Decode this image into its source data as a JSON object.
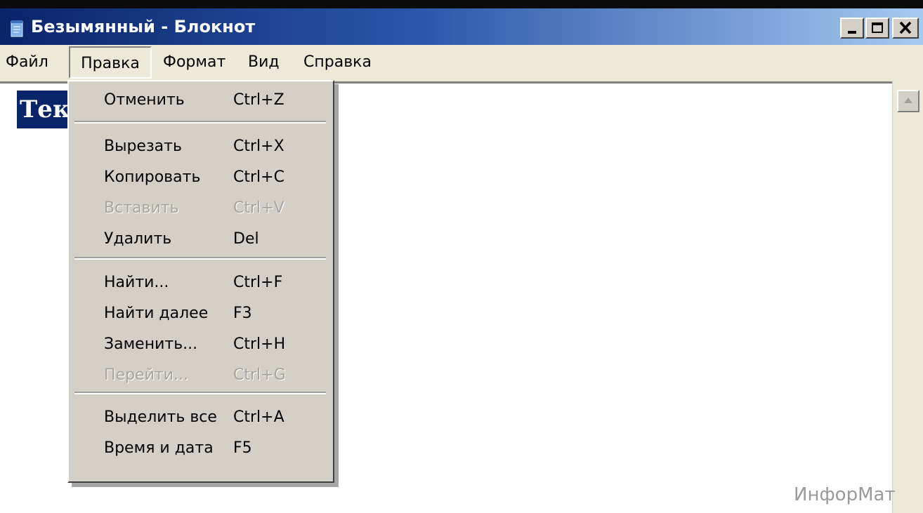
{
  "window": {
    "title": "Безымянный - Блокнот",
    "title_gradient_start": "#0a246a",
    "title_gradient_end": "#a6caf0",
    "icon": "notepad-icon"
  },
  "menubar": {
    "items": [
      {
        "label": "Файл"
      },
      {
        "label": "Правка",
        "open": true
      },
      {
        "label": "Формат"
      },
      {
        "label": "Вид"
      },
      {
        "label": "Справка"
      }
    ]
  },
  "editor": {
    "selected_text": "Тек",
    "selection_color": "#0a246a"
  },
  "edit_menu": {
    "groups": [
      [
        {
          "label": "Отменить",
          "shortcut": "Ctrl+Z",
          "enabled": true
        }
      ],
      [
        {
          "label": "Вырезать",
          "shortcut": "Ctrl+X",
          "enabled": true
        },
        {
          "label": "Копировать",
          "shortcut": "Ctrl+C",
          "enabled": true
        },
        {
          "label": "Вставить",
          "shortcut": "Ctrl+V",
          "enabled": false
        },
        {
          "label": "Удалить",
          "shortcut": "Del",
          "enabled": true
        }
      ],
      [
        {
          "label": "Найти...",
          "shortcut": "Ctrl+F",
          "enabled": true
        },
        {
          "label": "Найти далее",
          "shortcut": "F3",
          "enabled": true
        },
        {
          "label": "Заменить...",
          "shortcut": "Ctrl+H",
          "enabled": true
        },
        {
          "label": "Перейти...",
          "shortcut": "Ctrl+G",
          "enabled": false
        }
      ],
      [
        {
          "label": "Выделить все",
          "shortcut": "Ctrl+A",
          "enabled": true
        },
        {
          "label": "Время и дата",
          "shortcut": "F5",
          "enabled": true
        }
      ]
    ]
  },
  "watermark": "ИнфорМат"
}
